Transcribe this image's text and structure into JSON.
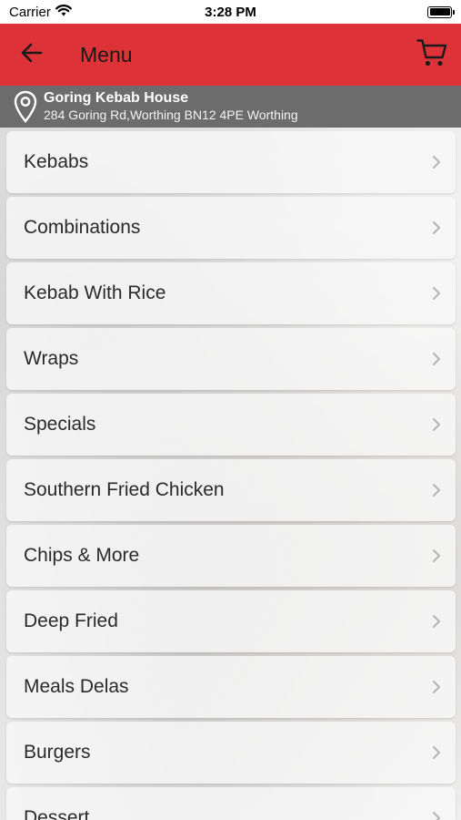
{
  "status_bar": {
    "carrier": "Carrier",
    "time": "3:28 PM"
  },
  "header": {
    "title": "Menu",
    "back_icon": "arrow-left-icon",
    "cart_icon": "cart-icon",
    "background_color": "#dd3338"
  },
  "location": {
    "icon": "map-pin-icon",
    "name": "Goring Kebab House",
    "address": "284 Goring Rd,Worthing BN12 4PE Worthing"
  },
  "menu": {
    "items": [
      {
        "label": "Kebabs"
      },
      {
        "label": "Combinations"
      },
      {
        "label": "Kebab With Rice"
      },
      {
        "label": "Wraps"
      },
      {
        "label": "Specials"
      },
      {
        "label": "Southern Fried Chicken"
      },
      {
        "label": "Chips & More"
      },
      {
        "label": "Deep Fried"
      },
      {
        "label": "Meals Delas"
      },
      {
        "label": "Burgers"
      },
      {
        "label": "Dessert"
      }
    ]
  }
}
